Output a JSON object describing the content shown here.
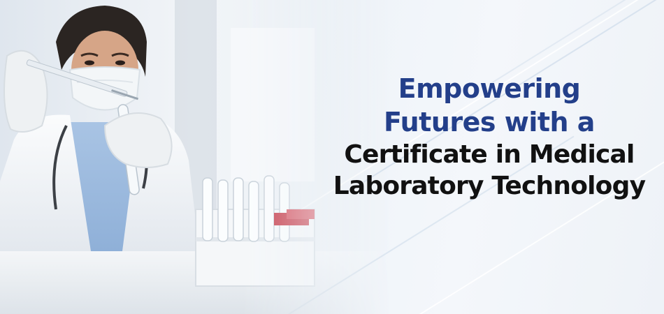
{
  "banner": {
    "headline": {
      "line1": "Empowering",
      "line2": "Futures with a",
      "line3": "Certificate in Medical",
      "line4": "Laboratory Technology"
    },
    "colors": {
      "headline_blue": "#233f8a",
      "headline_black": "#111111",
      "background": "#eef3f8"
    }
  }
}
